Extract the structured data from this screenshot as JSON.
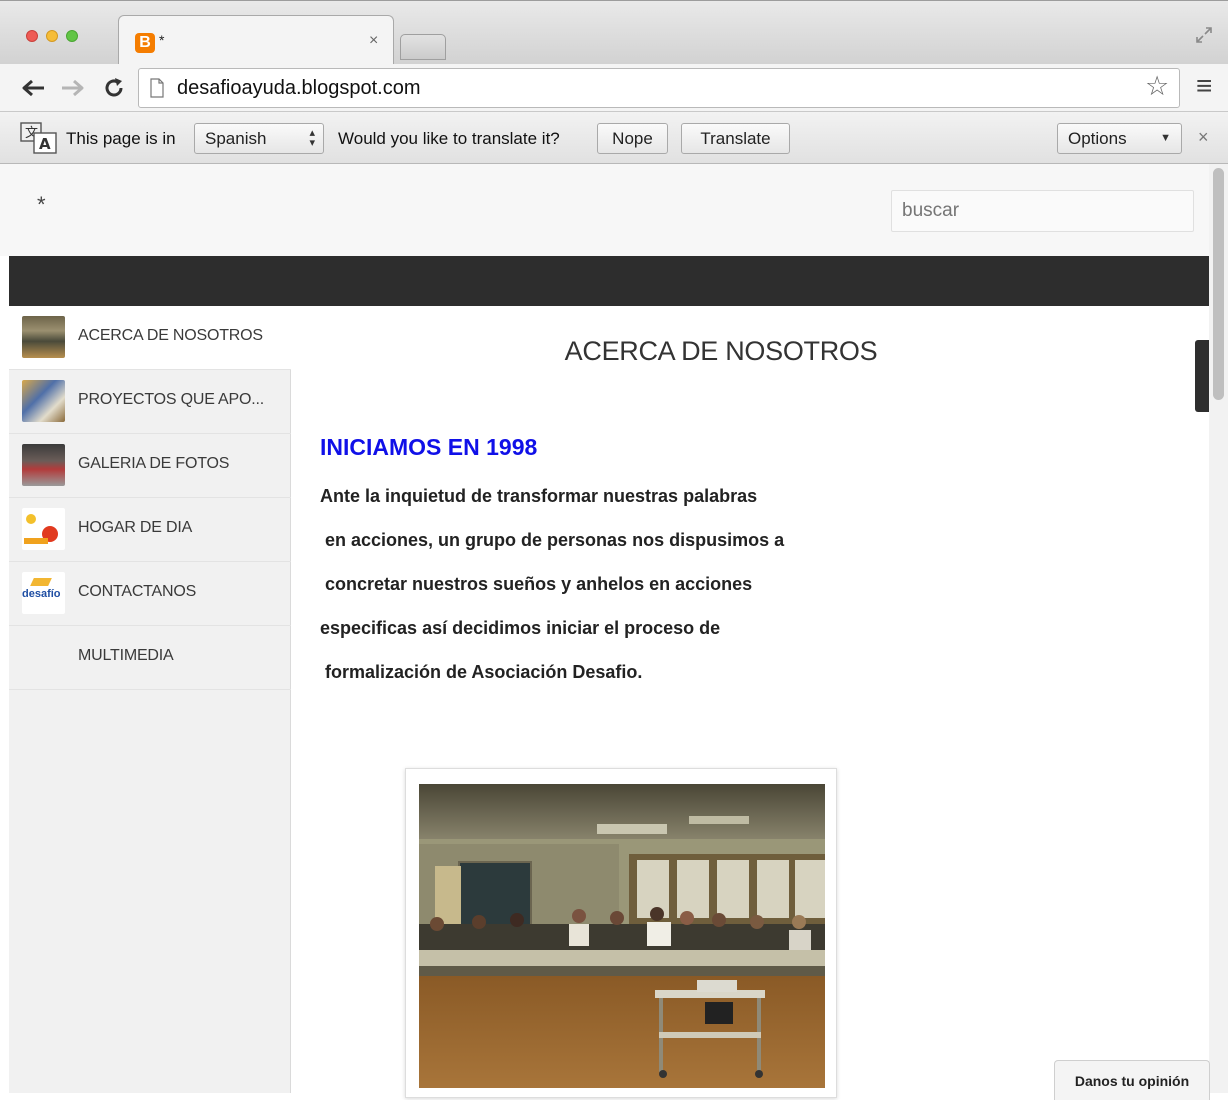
{
  "browser": {
    "tab_title": "*",
    "tab_close": "×",
    "url": "desafioayuda.blogspot.com",
    "star_glyph": "☆",
    "menu_glyph": "≡"
  },
  "infobar": {
    "prefix": "This page is in",
    "language": "Spanish",
    "question": "Would you like to translate it?",
    "nope_label": "Nope",
    "translate_label": "Translate",
    "options_label": "Options",
    "close_glyph": "×"
  },
  "header": {
    "star_glyph": "*",
    "search_placeholder": "buscar"
  },
  "sidebar": {
    "items": [
      {
        "label": "ACERCA DE NOSOTROS",
        "active": true
      },
      {
        "label": "PROYECTOS QUE APO..."
      },
      {
        "label": "GALERIA DE FOTOS"
      },
      {
        "label": "HOGAR DE DIA"
      },
      {
        "label": "CONTACTANOS"
      },
      {
        "label": "MULTIMEDIA"
      }
    ]
  },
  "main": {
    "page_title": "ACERCA DE NOSOTROS",
    "section_heading": "INICIAMOS EN 1998",
    "paragraph_lines": [
      "Ante la inquietud de transformar nuestras palabras",
      " en acciones, un grupo de personas nos dispusimos a",
      " concretar nuestros sueños y anhelos en acciones",
      "especificas así decidimos iniciar el proceso de",
      " formalización de Asociación Desafio."
    ]
  },
  "feedback_label": "Danos tu opinión",
  "colors": {
    "heading_blue": "#1010e8",
    "dark_band": "#2d2d2d",
    "blogger_orange": "#f57d00"
  }
}
